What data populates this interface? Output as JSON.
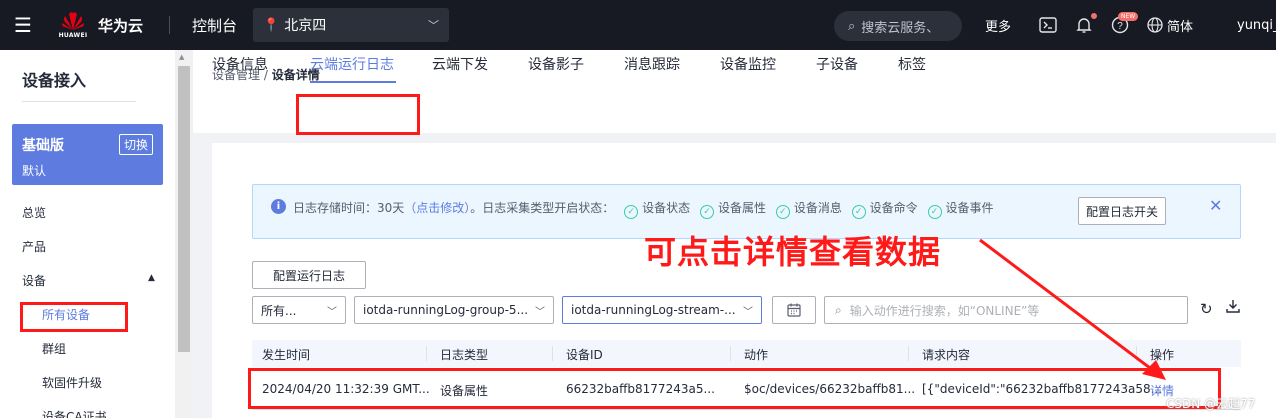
{
  "topbar": {
    "logo_text": "HUAWEI",
    "brand": "华为云",
    "console": "控制台",
    "region": "北京四",
    "search_placeholder": "搜索云服务、",
    "more": "更多",
    "new_badge": "NEW",
    "language": "简体",
    "user": "yunqi_"
  },
  "sidebar": {
    "title": "设备接入",
    "edition_name": "基础版",
    "edition_switch": "切换",
    "edition_sub": "默认",
    "items": {
      "overview": "总览",
      "product": "产品",
      "device": "设备",
      "all_devices": "所有设备",
      "group": "群组",
      "firmware": "软固件升级",
      "ca_cert": "设备CA证书"
    }
  },
  "breadcrumb": {
    "parent": "设备管理",
    "separator": " / ",
    "current": "设备详情"
  },
  "tabs": [
    "设备信息",
    "云端运行日志",
    "云端下发",
    "设备影子",
    "消息跟踪",
    "设备监控",
    "子设备",
    "标签"
  ],
  "info_bar": {
    "text1": "日志存储时间：30天",
    "link": "（点击修改）",
    "text2": "。日志采集类型开启状态：",
    "types": [
      "设备状态",
      "设备属性",
      "设备消息",
      "设备命令",
      "设备事件"
    ],
    "button": "配置日志开关"
  },
  "annotation": "可点击详情查看数据",
  "toolbar": {
    "config_button": "配置运行日志",
    "filter_type": "所有...",
    "log_group": "iotda-runningLog-group-5...",
    "log_stream": "iotda-runningLog-stream-...",
    "search_placeholder": "输入动作进行搜索，如“ONLINE”等"
  },
  "table": {
    "headers": [
      "发生时间",
      "日志类型",
      "设备ID",
      "动作",
      "请求内容",
      "操作"
    ],
    "rows": [
      {
        "time": "2024/04/20 11:32:39 GMT...",
        "type": "设备属性",
        "device_id": "66232baffb8177243a5...",
        "action": "$oc/devices/66232baffb81...",
        "request": "[{\"deviceId\":\"66232baffb8177243a58...",
        "op": "详情"
      }
    ]
  },
  "watermark": "CSDN @云起77",
  "colors": {
    "accent": "#5e7ce0",
    "annotation_red": "#ff1a1a",
    "topbar": "#171a22",
    "success": "#3dcca6"
  }
}
